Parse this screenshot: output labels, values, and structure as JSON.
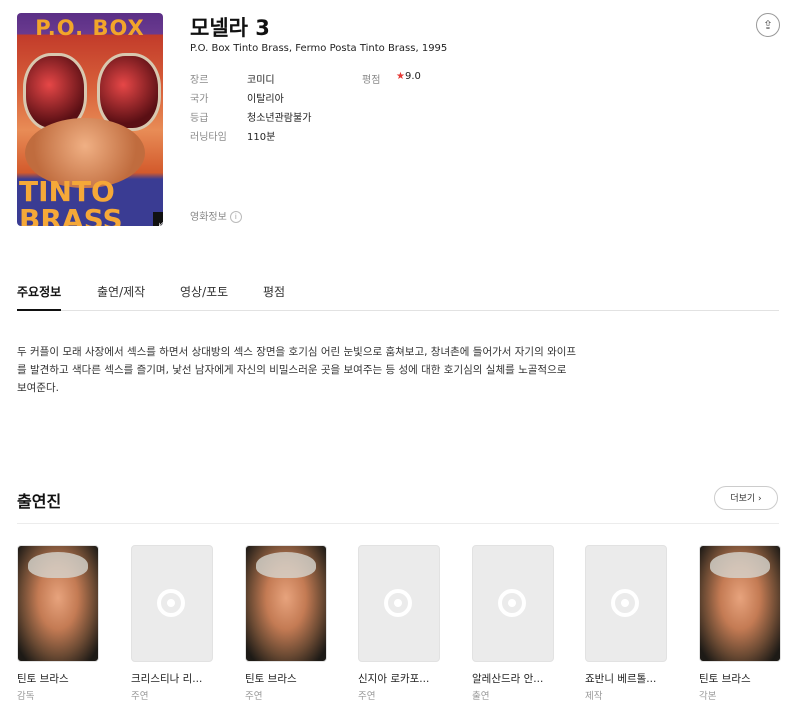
{
  "movie": {
    "title": "모넬라 3",
    "original_title": "P.O. Box Tinto Brass, Fermo Posta Tinto Brass, 1995",
    "poster_top_text": "P.O. BOX",
    "poster_bottom_text": "TINTO\nBRASS"
  },
  "details": {
    "genre_label": "장르",
    "genre": "코미디",
    "country_label": "국가",
    "country": "이탈리아",
    "rating_label": "등급",
    "rating": "청소년관람불가",
    "runtime_label": "러닝타임",
    "runtime": "110분",
    "score_label": "평점",
    "score_star": "★",
    "score": "9.0",
    "movie_info_label": "영화정보",
    "info_icon": "i"
  },
  "tabs": [
    "주요정보",
    "출연/제작",
    "영상/포토",
    "평점"
  ],
  "synopsis": "두 커플이 모래 사장에서 섹스를 하면서 상대방의 섹스 장면을 호기심 어린 눈빛으로 훔쳐보고, 창녀촌에 들어가서 자기의 와이프를 발견하고 색다른 섹스를 즐기며, 낯선 남자에게 자신의 비밀스러운 곳을 보여주는 등 성에 대한 호기심의 실체를 노골적으로 보여준다.",
  "cast": {
    "title": "출연진",
    "more_label": "더보기 ›",
    "people": [
      {
        "name": "틴토 브라스",
        "role": "감독",
        "photo": true
      },
      {
        "name": "크리스티나 리...",
        "role": "주연",
        "photo": false
      },
      {
        "name": "틴토 브라스",
        "role": "주연",
        "photo": true
      },
      {
        "name": "신지아 로카포...",
        "role": "주연",
        "photo": false
      },
      {
        "name": "알레산드라 안...",
        "role": "출연",
        "photo": false
      },
      {
        "name": "죠반니 베르톨...",
        "role": "제작",
        "photo": false
      },
      {
        "name": "틴토 브라스",
        "role": "각본",
        "photo": true
      }
    ]
  },
  "icons": {
    "share": "share-icon",
    "expand": "expand-icon",
    "placeholder": "film-reel-icon"
  }
}
